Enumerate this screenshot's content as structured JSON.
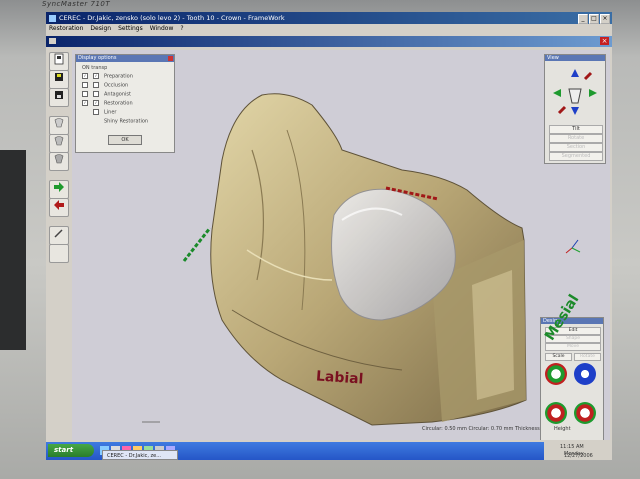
{
  "window": {
    "title": "CEREC - Dr.Jakic, zensko (solo levo 2) - Tooth  10  - Crown - FrameWork"
  },
  "menu": [
    "Restoration",
    "Design",
    "Settings",
    "Window",
    "?"
  ],
  "display_options": {
    "title": "Display options",
    "col_on": "ON",
    "col_transp": "transp",
    "items": [
      {
        "label": "Preparation",
        "on": true,
        "transp": true
      },
      {
        "label": "Occlusion",
        "on": false,
        "transp": false
      },
      {
        "label": "Antagonist",
        "on": false,
        "transp": false
      },
      {
        "label": "Restoration",
        "on": true,
        "transp": true
      },
      {
        "label": "Liner",
        "on": false,
        "transp": false
      },
      {
        "label": "Shiny Restoration",
        "on": false,
        "transp": false
      }
    ],
    "ok_label": "OK"
  },
  "view_panel": {
    "title": "View",
    "buttons": [
      {
        "label": "Tilt",
        "enabled": true
      },
      {
        "label": "Rotate",
        "enabled": false
      },
      {
        "label": "Section",
        "enabled": false
      },
      {
        "label": "Segmented",
        "enabled": false
      }
    ]
  },
  "design_panel": {
    "title": "Design",
    "buttons": [
      {
        "label": "Edit",
        "enabled": true
      },
      {
        "label": "Shape",
        "enabled": false
      },
      {
        "label": "Move",
        "enabled": false
      }
    ],
    "half_buttons": [
      {
        "label": "Scale",
        "enabled": true
      },
      {
        "label": "Rotate",
        "enabled": false
      }
    ]
  },
  "labels": {
    "labial": "Labial",
    "mesial": "Mesial"
  },
  "status": {
    "text": "Circular: 0.50 mm  Circular: 0.70 mm  Thickness",
    "height": "Height"
  },
  "taskbar": {
    "start": "start",
    "task": "CEREC - Dr.Jakic, ze...",
    "clock": "11:15 AM",
    "day": "Monday",
    "date": "12/27/2006"
  },
  "bezel": {
    "brand": "SyncMaster 710T"
  },
  "colors": {
    "titlebar": "#0a246a",
    "tooth": "#c8b88a",
    "restoration": "#d8d8dc",
    "background_3d": "#cfcdd6",
    "labial": "#7a1020",
    "mesial": "#1c8a2a"
  }
}
